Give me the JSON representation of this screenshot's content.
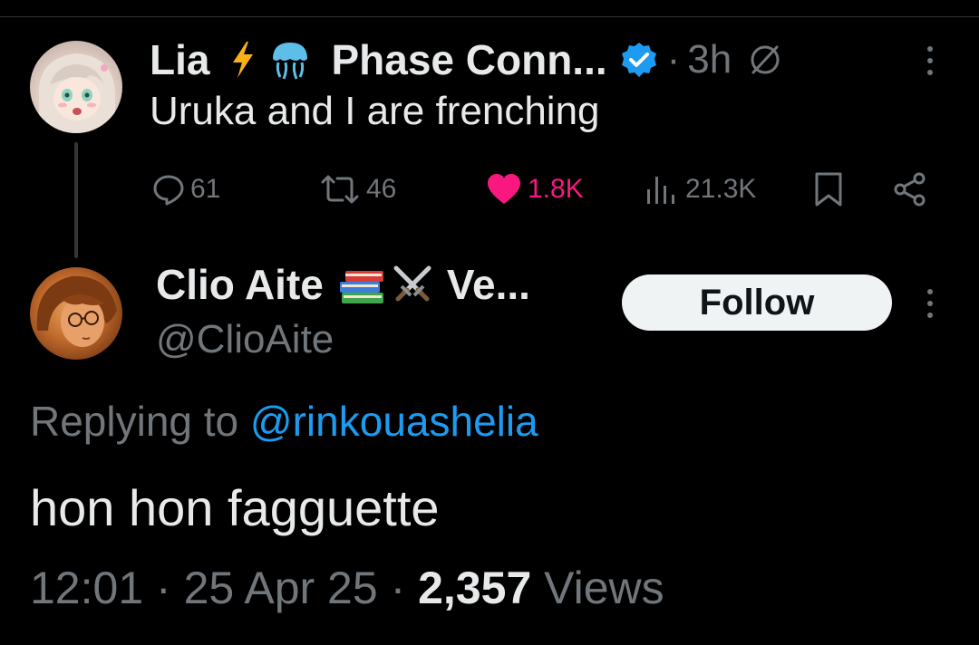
{
  "parent_tweet": {
    "display_name": "Lia",
    "name_suffix": "Phase Conn...",
    "time": "3h",
    "separator": "·",
    "text": "Uruka and I are frenching",
    "metrics": {
      "replies": "61",
      "reposts": "46",
      "likes": "1.8K",
      "views": "21.3K"
    },
    "colors": {
      "like": "#f91880",
      "verified": "#1d9bf0"
    }
  },
  "reply_tweet": {
    "display_name": "Clio Aite",
    "name_suffix": "Ve...",
    "handle": "@ClioAite",
    "follow_label": "Follow",
    "replying_prefix": "Replying to",
    "replying_to": "@rinkouashelia",
    "text": "hon hon fagguette",
    "time": "12:01",
    "date": "25 Apr 25",
    "views_count": "2,357",
    "views_label": "Views",
    "separator": "·"
  }
}
